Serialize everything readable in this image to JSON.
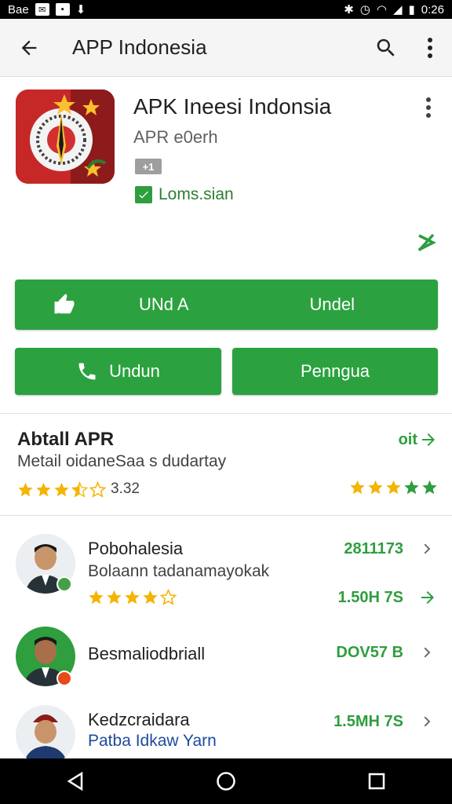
{
  "status_bar": {
    "left_label": "Bae",
    "time": "0:26"
  },
  "app_bar": {
    "title": "APP Indonesia"
  },
  "app": {
    "name": "APK Ineesi Indonsia",
    "developer": "APR e0erh",
    "badge": "+1",
    "verified_label": "Loms.sian"
  },
  "buttons": {
    "main_left": "UNd A",
    "main_right": "Undel",
    "secondary_left": "Undun",
    "secondary_right": "Penngua"
  },
  "about": {
    "title": "Abtall APR",
    "description": "Metail oidaneSaa s dudartay",
    "rating_value": "3.32",
    "link_text": "oit"
  },
  "reviews": [
    {
      "name": "Pobohalesia",
      "text": "Bolaann tadanamayokak",
      "size_top": "2811173",
      "size_bottom": "1.50H 7S",
      "stars": 4
    },
    {
      "name": "Besmaliodbriall",
      "text": "",
      "size_top": "DOV57 B",
      "size_bottom": "",
      "stars": 0
    },
    {
      "name": "Kedzcraidara",
      "text": "Patba Idkaw Yarn",
      "size_top": "1.5MH 7S",
      "size_bottom": "",
      "stars": 0
    }
  ],
  "colors": {
    "accent_green": "#2ba23f",
    "star_yellow": "#f4b400"
  }
}
